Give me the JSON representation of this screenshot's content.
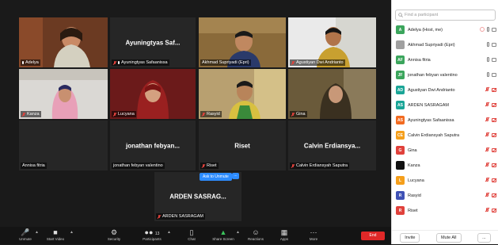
{
  "tiles": [
    {
      "name": "Adelya",
      "big": "",
      "muted": false,
      "photo": true
    },
    {
      "name": "Ayuningtyas Safaanissa",
      "big": "Ayuningtyas Saf...",
      "muted": true,
      "photo": false
    },
    {
      "name": "Akhmad Supriyadi (Epri)",
      "big": "",
      "muted": false,
      "photo": true
    },
    {
      "name": "Agustiyan Dwi Andrianto",
      "big": "",
      "muted": true,
      "photo": true
    },
    {
      "name": "Kanza",
      "big": "",
      "muted": true,
      "photo": true
    },
    {
      "name": "Lucyana",
      "big": "",
      "muted": true,
      "photo": true
    },
    {
      "name": "Rasyid",
      "big": "",
      "muted": true,
      "photo": true
    },
    {
      "name": "Gina",
      "big": "",
      "muted": true,
      "photo": true
    },
    {
      "name": "Annisa fitria",
      "big": "",
      "muted": false,
      "photo": false
    },
    {
      "name": "jonathan febyan valentino",
      "big": "jonathan febyan...",
      "muted": false,
      "photo": false
    },
    {
      "name": "Riset",
      "big": "Riset",
      "muted": true,
      "photo": false
    },
    {
      "name": "Calvin Erdiansyah Saputra",
      "big": "Calvin Erdiansya...",
      "muted": true,
      "photo": false
    },
    {
      "name": "ARDEN SASRAGAM",
      "big": "ARDEN SASRAG...",
      "muted": true,
      "photo": false
    }
  ],
  "ask_to_unmute": "Ask to Unmute",
  "ask_more": "...",
  "toolbar": {
    "unmute": "Unmute",
    "start_video": "Start Video",
    "security": "Security",
    "participants": "Participants",
    "participants_count": "13",
    "chat": "Chat",
    "share_screen": "Share Screen",
    "reactions": "Reactions",
    "apps": "Apps",
    "more": "More",
    "end": "End"
  },
  "panel": {
    "search_placeholder": "Find a participant",
    "participants": [
      {
        "initials": "A",
        "name": "Adelya (Host, me)",
        "color": "#3ba55c",
        "status": "host"
      },
      {
        "initials": "",
        "name": "Akhmad Supriyadi (Epri)",
        "color": "#a0a0a0",
        "status": "on"
      },
      {
        "initials": "AF",
        "name": "Annisa fitria",
        "color": "#3ba55c",
        "status": "on"
      },
      {
        "initials": "JF",
        "name": "jonathan febyan valentino",
        "color": "#3ba55c",
        "status": "on"
      },
      {
        "initials": "AD",
        "name": "Agustiyan Dwi Andrianto",
        "color": "#1aa597",
        "status": "muted"
      },
      {
        "initials": "AS",
        "name": "ARDEN SASRAGAM",
        "color": "#1aa597",
        "status": "muted"
      },
      {
        "initials": "AS",
        "name": "Ayuningtyas Safaanissa",
        "color": "#f26b21",
        "status": "muted"
      },
      {
        "initials": "CE",
        "name": "Calvin Erdiansyah Saputra",
        "color": "#f59f1b",
        "status": "muted"
      },
      {
        "initials": "G",
        "name": "Gina",
        "color": "#e0413b",
        "status": "muted"
      },
      {
        "initials": "",
        "name": "Kanza",
        "color": "#111111",
        "status": "muted"
      },
      {
        "initials": "L",
        "name": "Lucyana",
        "color": "#f59f1b",
        "status": "muted"
      },
      {
        "initials": "R",
        "name": "Rasyid",
        "color": "#3f51b5",
        "status": "muted"
      },
      {
        "initials": "R",
        "name": "Riset",
        "color": "#e0413b",
        "status": "muted"
      }
    ],
    "invite": "Invite",
    "mute_all": "Mute All",
    "more": "..."
  }
}
